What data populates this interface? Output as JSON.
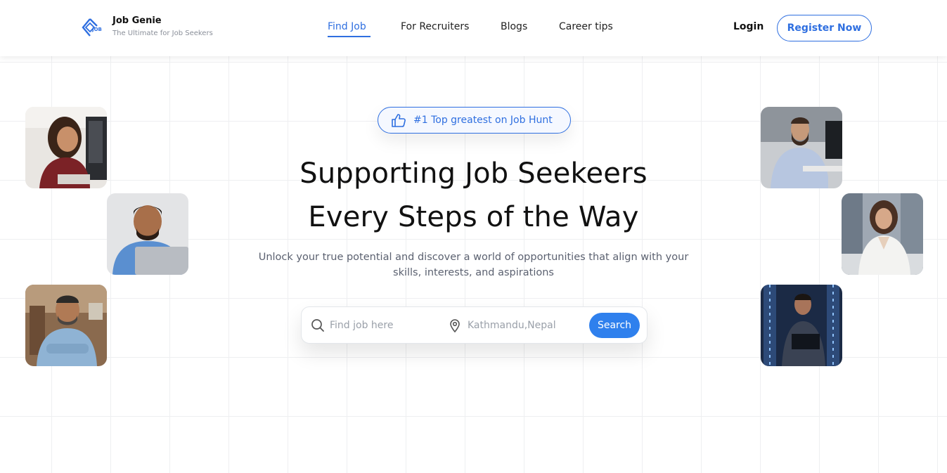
{
  "brand": {
    "name": "Job Genie",
    "tagline": "The Ultimate for Job Seekers",
    "logo_text": "JOB"
  },
  "nav": {
    "items": [
      "Find Job",
      "For Recruiters",
      "Blogs",
      "Career tips"
    ],
    "active": "Find Job"
  },
  "auth": {
    "login": "Login",
    "register": "Register Now"
  },
  "hero": {
    "badge": "#1 Top greatest on Job Hunt",
    "headline_line1": "Supporting Job Seekeers",
    "headline_line2": "Every Steps of the Way",
    "subtext": "Unlock your true potential and discover a world of opportunities that align with your skills, interests, and aspirations"
  },
  "search": {
    "placeholder": "Find job here",
    "location_value": "Kathmandu,Nepal",
    "button": "Search"
  },
  "photos": [
    "woman-headset-photo",
    "man-laptop-photo",
    "man-arms-crossed-photo",
    "man-desk-photo",
    "woman-white-blazer-photo",
    "man-server-room-photo"
  ],
  "colors": {
    "accent": "#2f6fe0",
    "button": "#2f80ed",
    "text": "#111111",
    "muted": "#5b6170"
  }
}
